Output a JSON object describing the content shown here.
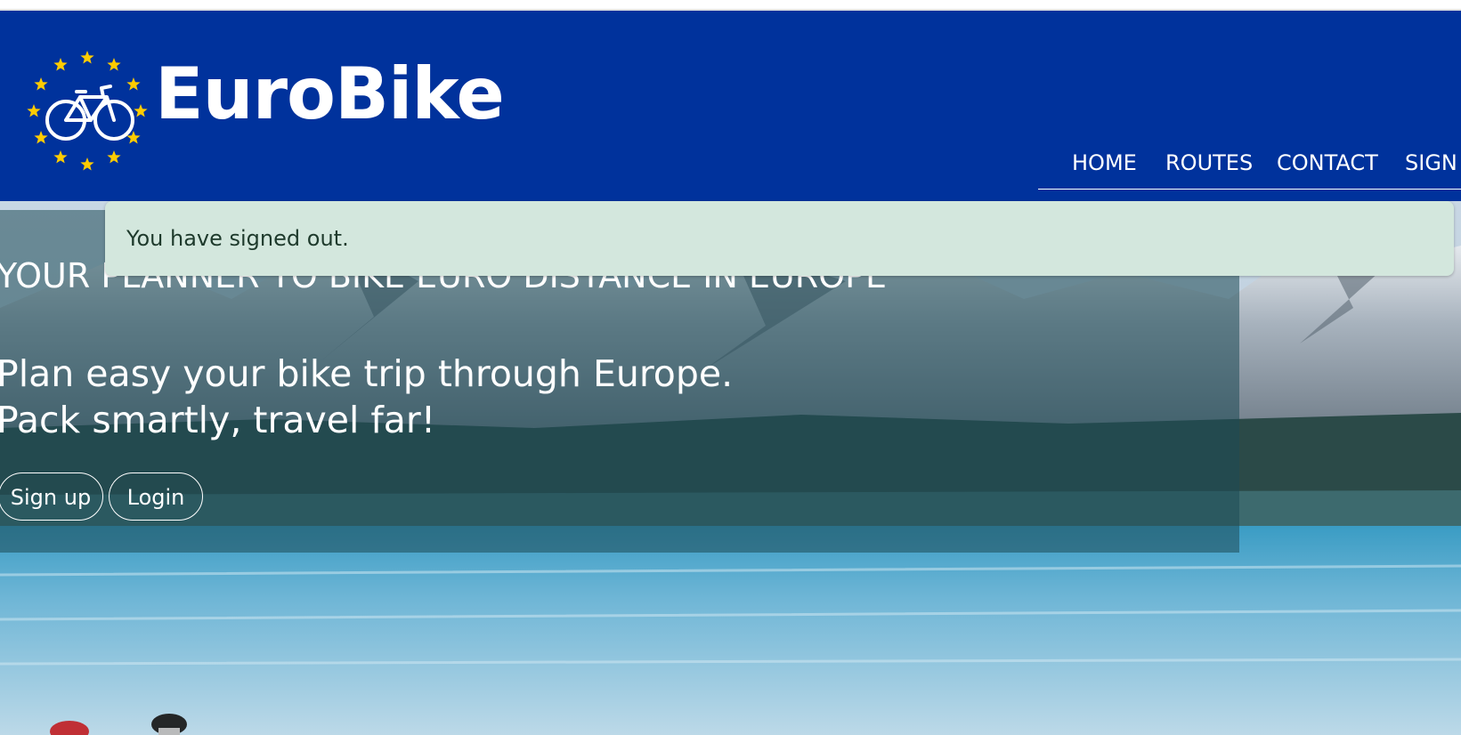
{
  "brand": {
    "name": "EuroBike",
    "logo_icon": "eu-stars-bicycle-logo",
    "colors": {
      "header": "#00329c",
      "stars": "#ffcc00"
    }
  },
  "nav": {
    "items": [
      {
        "label": "HOME"
      },
      {
        "label": "ROUTES"
      },
      {
        "label": "CONTACT"
      },
      {
        "label": "SIGN"
      }
    ]
  },
  "alert": {
    "message": "You have signed out.",
    "color": "#d3e7dd"
  },
  "hero": {
    "tagline": "YOUR PLANNER TO BIKE EURO DISTANCE IN EUROPE",
    "line1": "Plan easy your bike trip through Europe.",
    "line2": "Pack smartly, travel far!",
    "signup_label": "Sign up",
    "login_label": "Login"
  }
}
